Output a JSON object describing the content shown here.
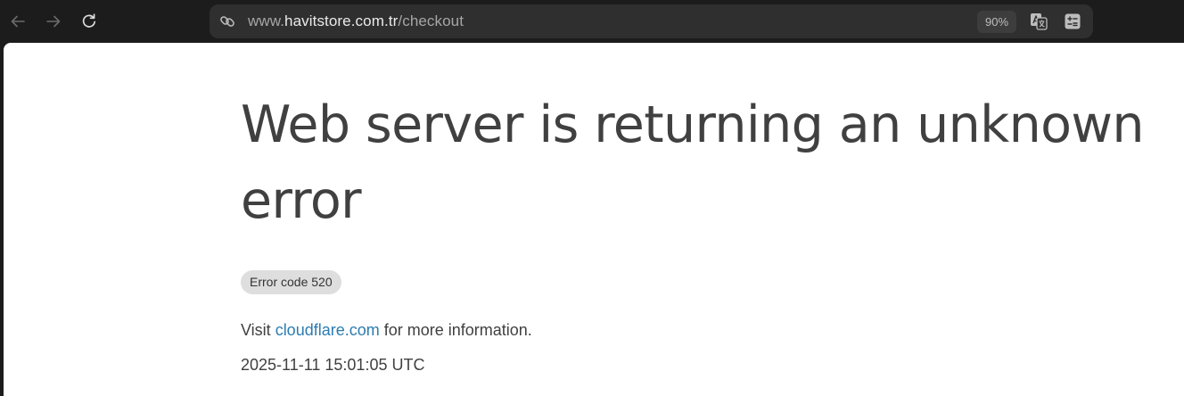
{
  "browser": {
    "url": {
      "host_sub": "www.",
      "host_main": "havitstore.com.tr",
      "path": "/checkout"
    },
    "zoom": "90%"
  },
  "page": {
    "headline": "Web server is returning an unknown error",
    "error_code": "Error code 520",
    "info_prefix": "Visit ",
    "info_link": "cloudflare.com",
    "info_suffix": " for more information.",
    "timestamp": "2025-11-11 15:01:05 UTC"
  }
}
